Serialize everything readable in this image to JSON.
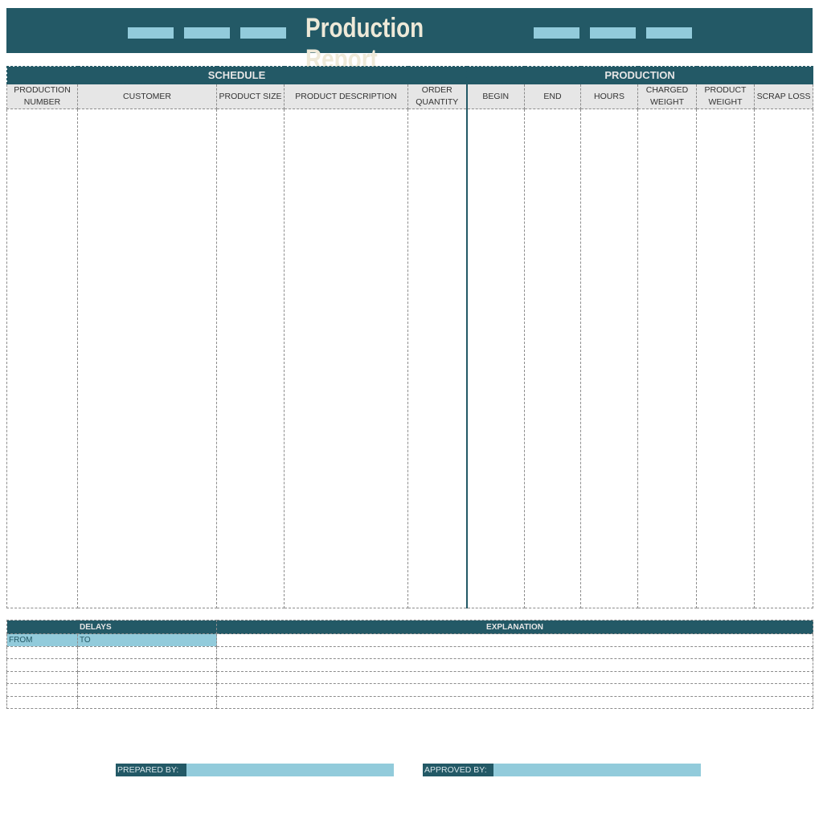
{
  "header": {
    "title": "Production Report",
    "accent_color": "#235966",
    "dash_color": "#92cbdb"
  },
  "main_table": {
    "sections": [
      {
        "label": "SCHEDULE"
      },
      {
        "label": "PRODUCTION"
      }
    ],
    "columns": [
      "PRODUCTION NUMBER",
      "CUSTOMER",
      "PRODUCT SIZE",
      "PRODUCT DESCRIPTION",
      "ORDER QUANTITY",
      "BEGIN",
      "END",
      "HOURS",
      "CHARGED WEIGHT",
      "PRODUCT WEIGHT",
      "SCRAP LOSS"
    ]
  },
  "delays_table": {
    "delays_label": "DELAYS",
    "explanation_label": "EXPLANATION",
    "from_label": "FROM",
    "to_label": "TO"
  },
  "signatures": {
    "prepared_by": "PREPARED BY:",
    "approved_by": "APPROVED BY:"
  }
}
